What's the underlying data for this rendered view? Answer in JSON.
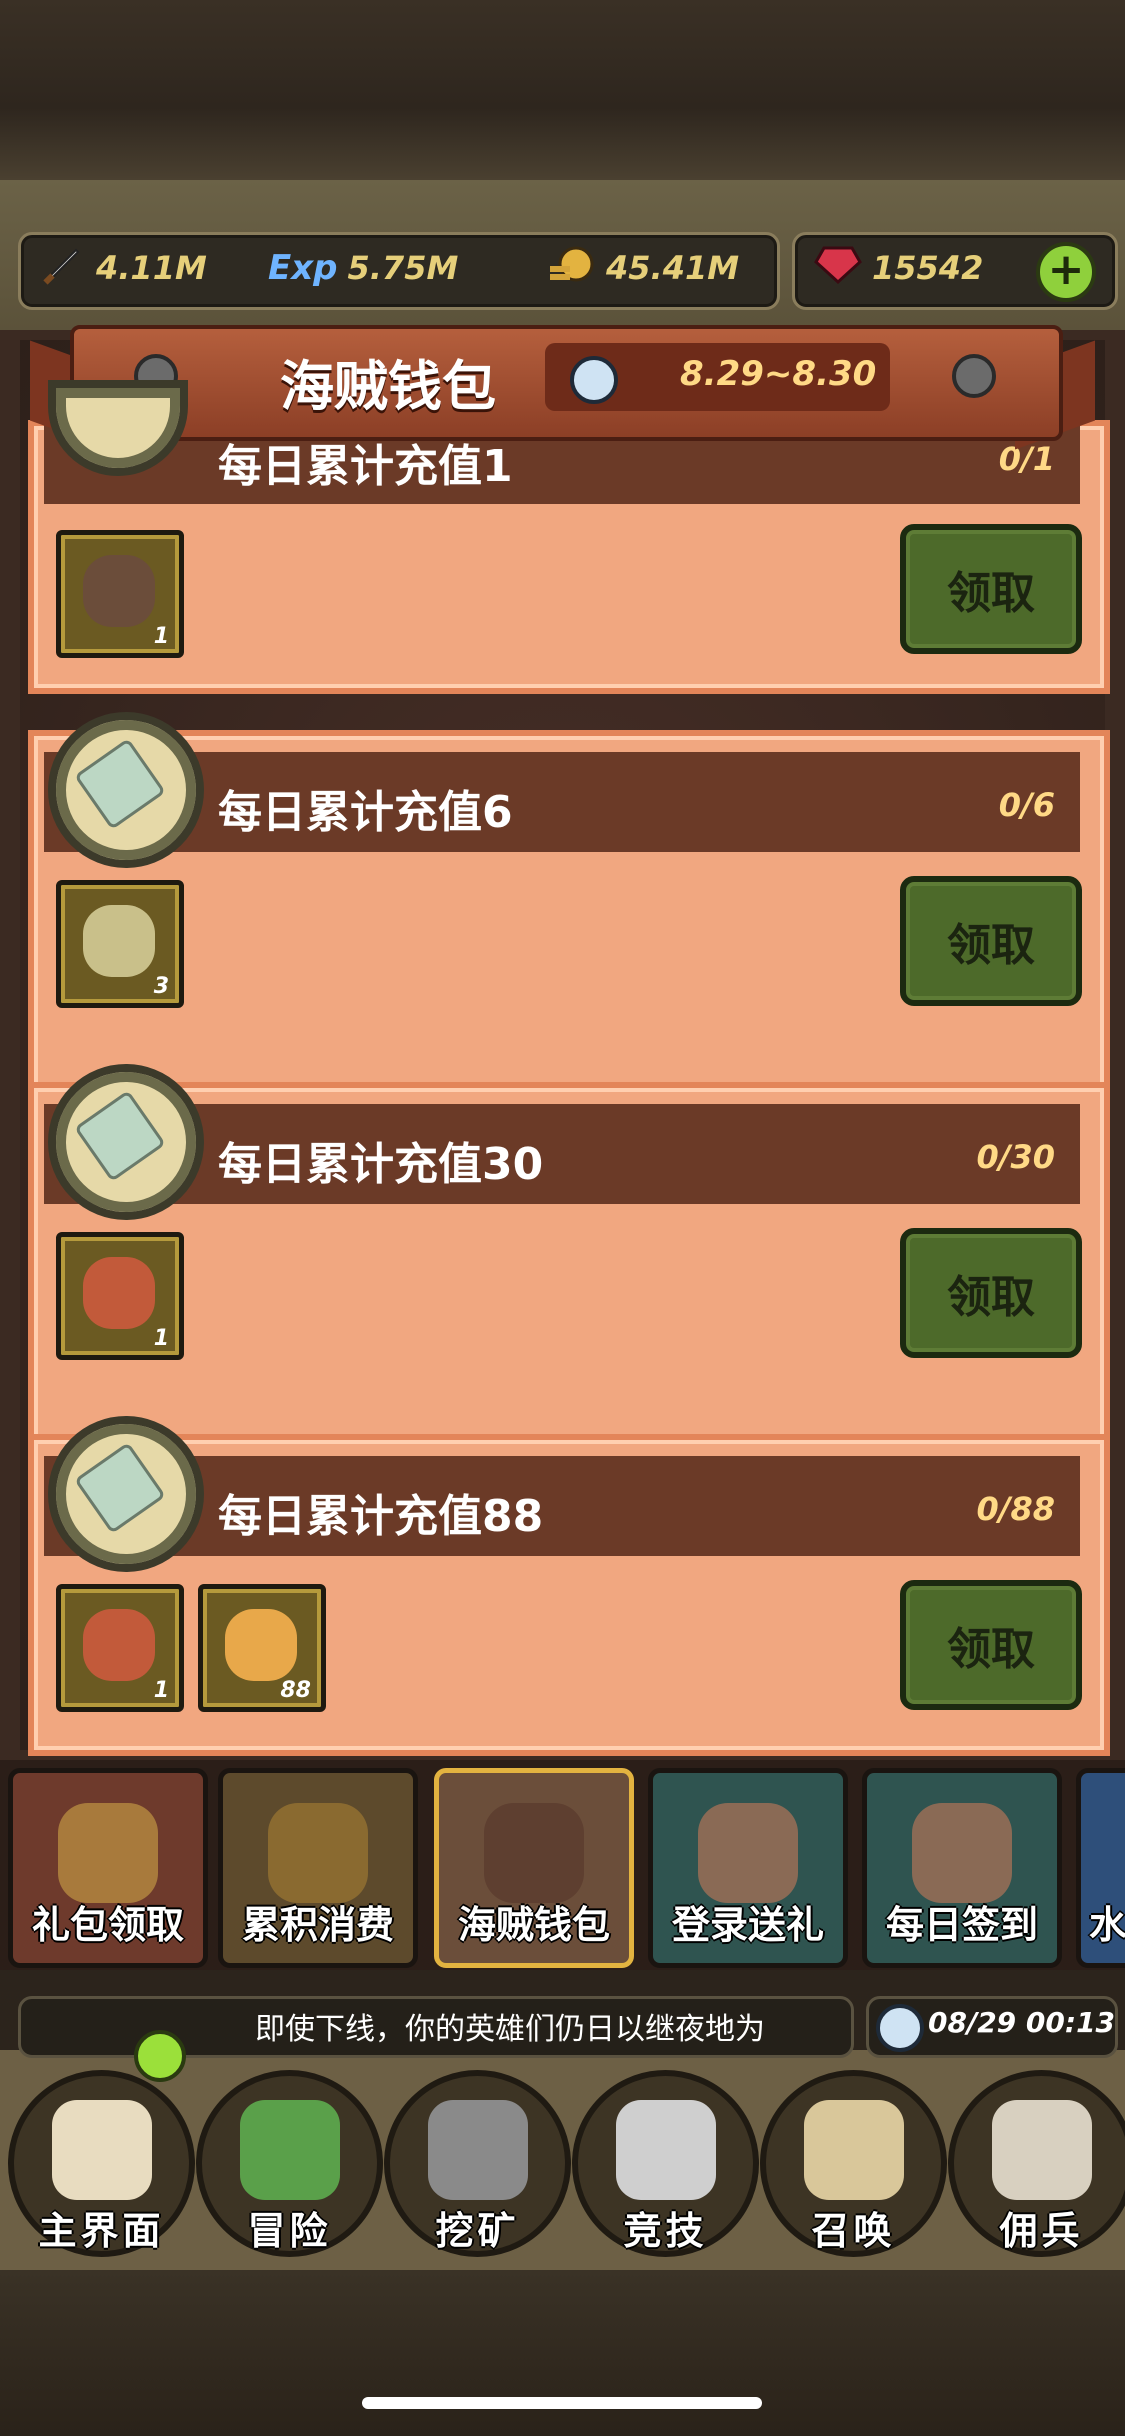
{
  "currency": {
    "attack": "4.11M",
    "exp_icon": "Exp",
    "exp": "5.75M",
    "gold": "45.41M",
    "gems": "15542"
  },
  "header": {
    "title": "海贼钱包",
    "date_range": "8.29~8.30"
  },
  "cards": [
    {
      "title": "每日累计充值1",
      "progress": "0/1",
      "items": [
        {
          "name": "pirate-purse",
          "count": "1"
        }
      ],
      "claim": "领取"
    },
    {
      "title": "每日累计充值6",
      "progress": "0/6",
      "items": [
        {
          "name": "skull-key",
          "count": "3"
        }
      ],
      "claim": "领取"
    },
    {
      "title": "每日累计充值30",
      "progress": "0/30",
      "items": [
        {
          "name": "gift-bag",
          "count": "1"
        }
      ],
      "claim": "领取"
    },
    {
      "title": "每日累计充值88",
      "progress": "0/88",
      "items": [
        {
          "name": "gift-bag",
          "count": "1"
        },
        {
          "name": "gold-crystal",
          "count": "88"
        }
      ],
      "claim": "领取"
    }
  ],
  "tabs": [
    {
      "label": "礼包领取"
    },
    {
      "label": "累积消费"
    },
    {
      "label": "海贼钱包"
    },
    {
      "label": "登录送礼"
    },
    {
      "label": "每日签到"
    },
    {
      "label": "水"
    }
  ],
  "ticker": {
    "text": "即使下线，你的英雄们仍日以继夜地为",
    "time": "08/29 00:13"
  },
  "nav": [
    {
      "label": "主界面"
    },
    {
      "label": "冒险"
    },
    {
      "label": "挖矿"
    },
    {
      "label": "竞技"
    },
    {
      "label": "召唤"
    },
    {
      "label": "佣兵"
    }
  ],
  "colors": {
    "card_bg": "#f1a780",
    "header_bg": "#6b3a27",
    "claim_green": "#4d6a2a",
    "gold_text": "#ffd986"
  }
}
